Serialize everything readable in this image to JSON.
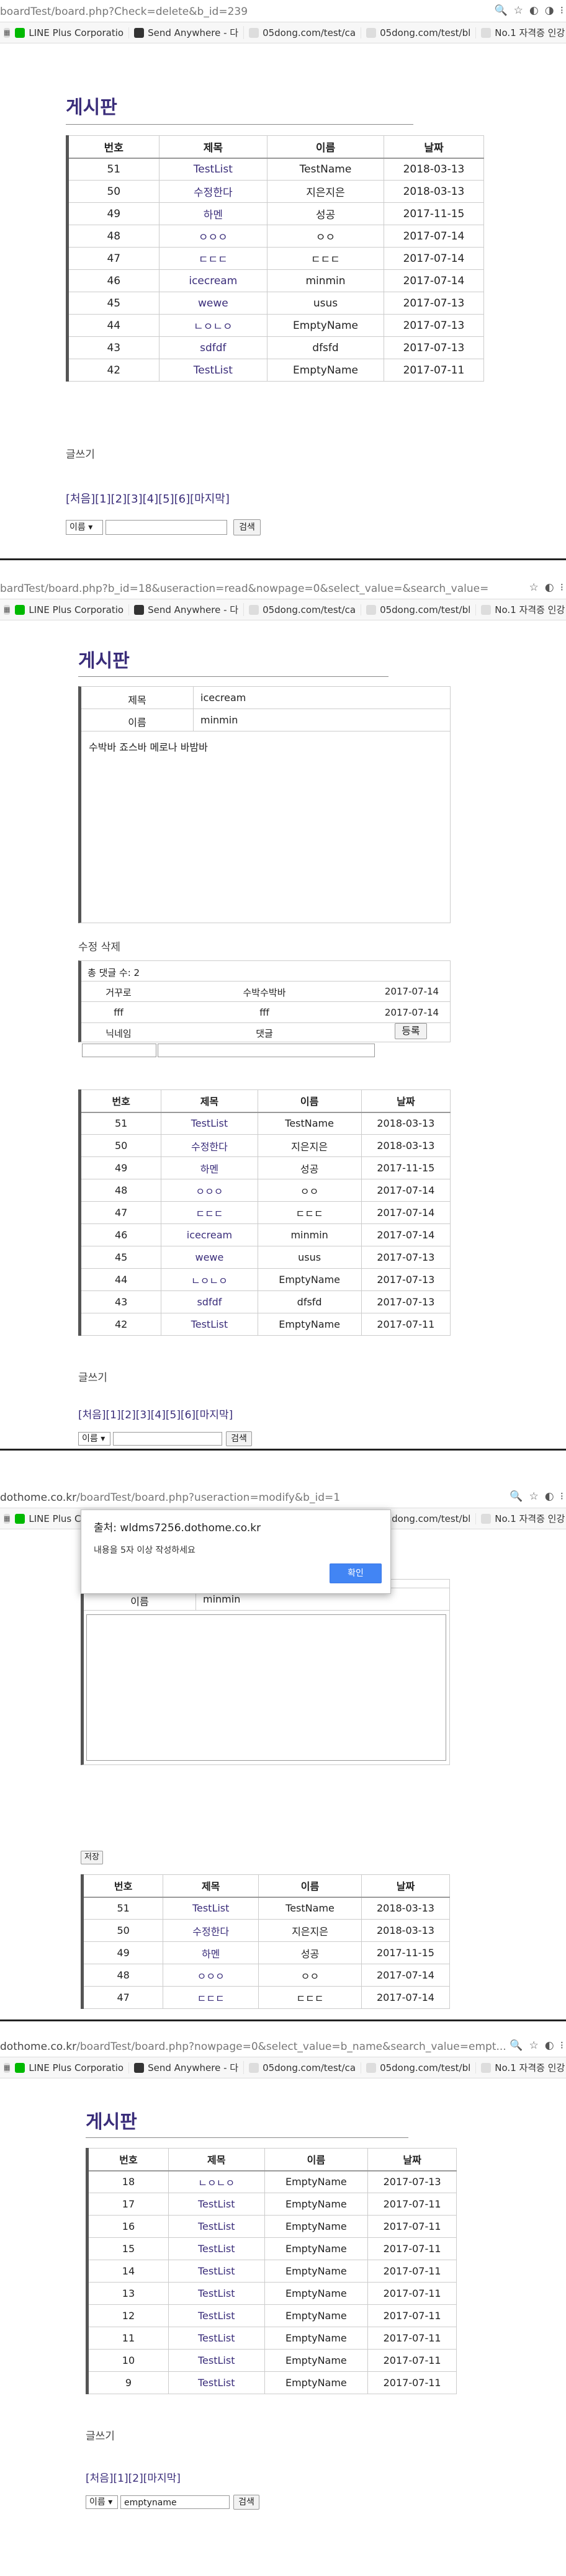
{
  "s1": {
    "url_dim": "boardTest/board.php?Check=delete&b_id=239",
    "url_host": ""
  },
  "s2": {
    "url_dim": "bardTest/board.php?b_id=18&useraction=read&nowpage=0&select_value=&search_value="
  },
  "s3": {
    "url_host": "dothome.co.kr",
    "url_dim": "/boardTest/board.php?useraction=modify&b_id=1"
  },
  "s4": {
    "url_host": "dothome.co.kr",
    "url_dim": "/boardTest/board.php?nowpage=0&select_value=b_name&search_value=empt..."
  },
  "bookmarks": [
    "LINE Plus Corporatio",
    "Send Anywhere - 다",
    "05dong.com/test/ca",
    "05dong.com/test/bl",
    "No.1 자격증 인강!"
  ],
  "board": {
    "title": "게시판",
    "headers": [
      "번호",
      "제목",
      "이름",
      "날짜"
    ],
    "rows": [
      [
        "51",
        "TestList",
        "TestName",
        "2018-03-13"
      ],
      [
        "50",
        "수정한다",
        "지은지은",
        "2018-03-13"
      ],
      [
        "49",
        "하멘",
        "성공",
        "2017-11-15"
      ],
      [
        "48",
        "ㅇㅇㅇ",
        "ㅇㅇ",
        "2017-07-14"
      ],
      [
        "47",
        "ㄷㄷㄷ",
        "ㄷㄷㄷ",
        "2017-07-14"
      ],
      [
        "46",
        "icecream",
        "minmin",
        "2017-07-14"
      ],
      [
        "45",
        "wewe",
        "usus",
        "2017-07-13"
      ],
      [
        "44",
        "ㄴㅇㄴㅇ",
        "EmptyName",
        "2017-07-13"
      ],
      [
        "43",
        "sdfdf",
        "dfsfd",
        "2017-07-13"
      ],
      [
        "42",
        "TestList",
        "EmptyName",
        "2017-07-11"
      ]
    ],
    "write": "글쓰기",
    "pager": "[처음][1][2][3][4][5][6][마지막]",
    "select": "이름 ▾",
    "search_btn": "검색"
  },
  "read": {
    "label_title": "제목",
    "value_title": "icecream",
    "label_name": "이름",
    "value_name": "minmin",
    "content": "수박바 죠스바 메로나 바밤바",
    "edit_delete": "수정 삭제",
    "comment_count": "총 댓글 수: 2",
    "comments": [
      [
        "거꾸로",
        "수박수박바",
        "2017-07-14"
      ],
      [
        "fff",
        "fff",
        "2017-07-14"
      ]
    ],
    "nick_label": "닉네임",
    "comment_label": "댓글",
    "submit": "등록"
  },
  "modify": {
    "dialog_title": "출처: wldms7256.dothome.co.kr",
    "dialog_msg": "내용을 5자 이상 작성하세요",
    "dialog_ok": "확인",
    "label_name": "이름",
    "value_name": "minmin",
    "save": "저장"
  },
  "search": {
    "rows": [
      [
        "18",
        "ㄴㅇㄴㅇ",
        "EmptyName",
        "2017-07-13"
      ],
      [
        "17",
        "TestList",
        "EmptyName",
        "2017-07-11"
      ],
      [
        "16",
        "TestList",
        "EmptyName",
        "2017-07-11"
      ],
      [
        "15",
        "TestList",
        "EmptyName",
        "2017-07-11"
      ],
      [
        "14",
        "TestList",
        "EmptyName",
        "2017-07-11"
      ],
      [
        "13",
        "TestList",
        "EmptyName",
        "2017-07-11"
      ],
      [
        "12",
        "TestList",
        "EmptyName",
        "2017-07-11"
      ],
      [
        "11",
        "TestList",
        "EmptyName",
        "2017-07-11"
      ],
      [
        "10",
        "TestList",
        "EmptyName",
        "2017-07-11"
      ],
      [
        "9",
        "TestList",
        "EmptyName",
        "2017-07-11"
      ]
    ],
    "pager": "[처음][1][2][마지막]",
    "query": "emptyname"
  }
}
